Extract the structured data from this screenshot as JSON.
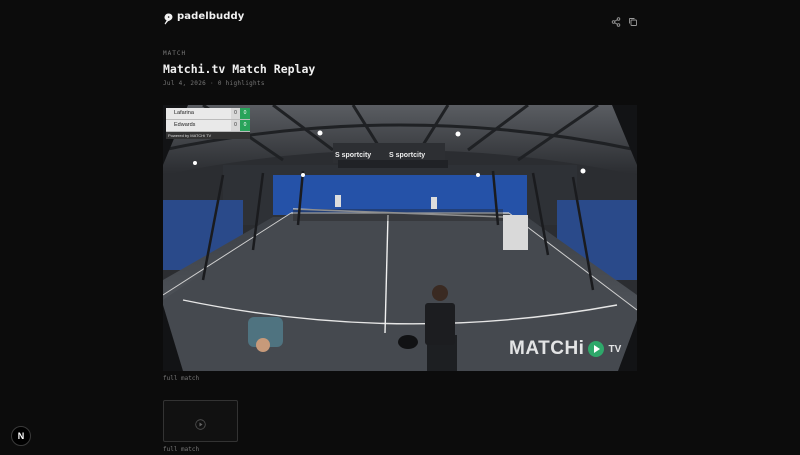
{
  "brand": {
    "name": "padelbuddy",
    "icon": "padel-logo-icon"
  },
  "header": {
    "share_icon": "share-icon",
    "copy_icon": "copy-icon"
  },
  "match": {
    "kicker": "MATCH",
    "title": "Matchi.tv Match Replay",
    "date": "Jul 4, 2026",
    "separator": "·",
    "highlights": "0 highlights"
  },
  "video": {
    "scoreboard": {
      "rows": [
        {
          "name": "Lafarina",
          "score": "0",
          "set": "0"
        },
        {
          "name": "Edwards",
          "score": "0",
          "set": "0"
        }
      ],
      "footer": "Powered by MATCHi TV"
    },
    "court_banners": [
      "sportcity",
      "sportcity"
    ],
    "watermark": "MATCHi",
    "watermark_suffix": "TV",
    "caption": "full match"
  },
  "clips": [
    {
      "label": "full match",
      "icon": "play-icon"
    }
  ],
  "dev_badge": {
    "letter": "N"
  },
  "colors": {
    "background": "#0c0c0c",
    "court": "#4a4f55",
    "score_green": "#29a35a"
  }
}
